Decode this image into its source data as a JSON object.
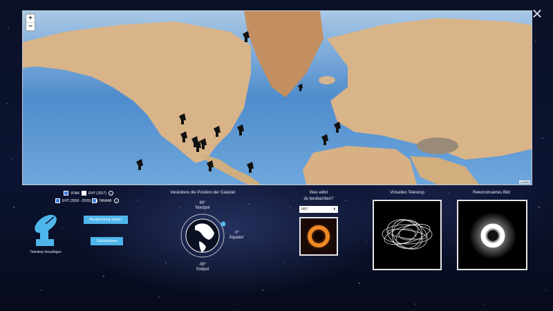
{
  "map": {
    "zoom_in": "+",
    "zoom_out": "−",
    "attribution": "Leaflet"
  },
  "close_label": "✕",
  "checkboxes": [
    {
      "label": "VLBA",
      "checked": true
    },
    {
      "label": "EHT (2017)",
      "checked": false
    },
    {
      "label": "EHT (2018 - 2020)",
      "checked": true
    },
    {
      "label": "TANAMI",
      "checked": true
    }
  ],
  "info_glyph": "i",
  "buttons": {
    "start": "Beobachtung starten",
    "reset": "Zurücksetzen"
  },
  "add_telescope_label": "Teleskop hinzufügen",
  "galaxy": {
    "title": "Verändere die Position der Galaxie!",
    "north_deg": "90°",
    "north_name": "Nordpol",
    "equator_deg": "0°",
    "equator_name": "Äquator",
    "south_deg": "-90°",
    "south_name": "Südpol"
  },
  "target": {
    "question_line1": "Was willst",
    "question_line2": "du beobachten?",
    "selected": "M87"
  },
  "virtual_telescope_title": "Virtuelles Teleskop",
  "reconstructed_title": "Rekonstruiertes Bild",
  "colors": {
    "button": "#4fb6ec",
    "ocean": "#6aa2d6",
    "land": "#d9b489",
    "accent": "#3a7be0"
  }
}
